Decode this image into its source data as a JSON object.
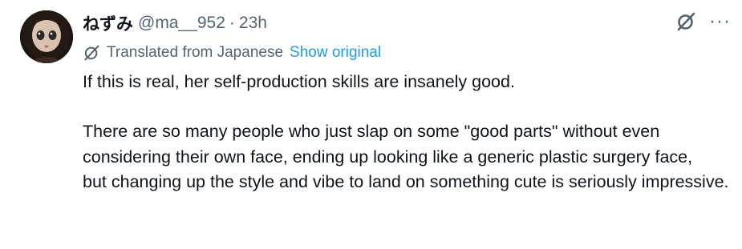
{
  "tweet": {
    "author": {
      "display_name": "ねずみ",
      "handle": "@ma__952",
      "separator": "·",
      "time": "23h"
    },
    "icons": {
      "grok": "grok-icon",
      "more": "more-icon",
      "translate": "translate-icon"
    },
    "more_glyph": "···",
    "translation": {
      "label": "Translated from Japanese",
      "show_original": "Show original"
    },
    "paragraphs": [
      "If this is real, her self-production skills are insanely good.",
      "There are so many people who just slap on some \"good parts\" without even considering their own face, ending up looking like a generic plastic surgery face,",
      "but changing up the style and vibe to land on something cute is seriously impressive."
    ],
    "colors": {
      "text": "#0f1419",
      "secondary": "#536471",
      "link": "#1d9bf0"
    }
  }
}
